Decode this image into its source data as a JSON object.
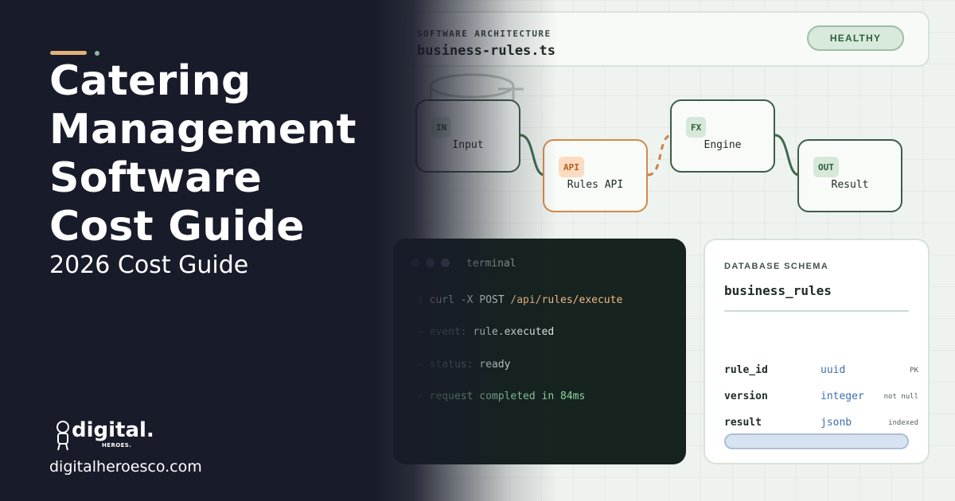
{
  "hero": {
    "headline_lines": [
      "Catering",
      "Management",
      "Software",
      "Cost Guide"
    ],
    "subheadline": "2026 Cost Guide"
  },
  "brand": {
    "wordmark": "digital.",
    "subtitle": "HEROES.",
    "url": "digitalheroesco.com"
  },
  "architecture": {
    "kicker": "SOFTWARE ARCHITECTURE",
    "filename": "business-rules.ts",
    "status": "HEALTHY"
  },
  "flow": {
    "nodes": [
      {
        "tag": "IN",
        "label": "Input"
      },
      {
        "tag": "API",
        "label": "Rules API"
      },
      {
        "tag": "FX",
        "label": "Engine"
      },
      {
        "tag": "OUT",
        "label": "Result"
      }
    ]
  },
  "terminal": {
    "title": "terminal",
    "command_prompt": "$",
    "command": "curl -X POST",
    "command_path": "/api/rules/execute",
    "event_key": "→ event:",
    "event_value": "rule.executed",
    "status_key": "→ status:",
    "status_value": "ready",
    "done_mark": "✓",
    "done_text": "request completed in 84ms"
  },
  "schema": {
    "kicker": "DATABASE SCHEMA",
    "table": "business_rules",
    "columns": [
      {
        "name": "rule_id",
        "type": "uuid",
        "flag": "PK"
      },
      {
        "name": "version",
        "type": "integer",
        "flag": "not null"
      },
      {
        "name": "result",
        "type": "jsonb",
        "flag": "indexed"
      }
    ]
  },
  "colors": {
    "left_panel": "#181b2a",
    "accent": "#e1b17a",
    "node_border": "#3f5c49",
    "api_accent": "#d28a4a",
    "terminal_bg": "#16231f"
  }
}
